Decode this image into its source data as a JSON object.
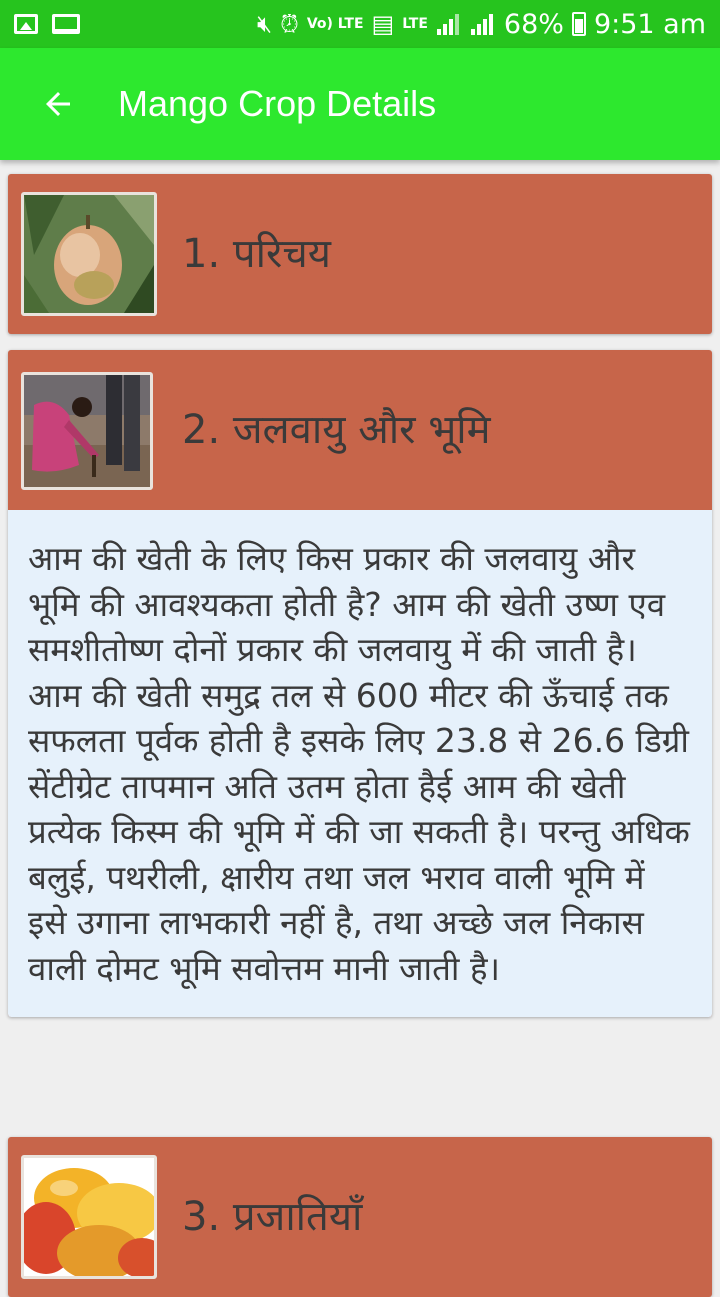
{
  "status_bar": {
    "battery": "68%",
    "time": "9:51 am",
    "volte_label": "Vo) LTE",
    "lte_label": "LTE"
  },
  "app_bar": {
    "title": "Mango Crop Details",
    "back_icon": "arrow-left-icon"
  },
  "sections": [
    {
      "title": "1. परिचय",
      "image": "mango-on-tree-photo"
    },
    {
      "title": "2. जलवायु और भूमि",
      "image": "farmer-planting-photo",
      "body": "आम की खेती के लिए किस प्रकार की जलवायु और भूमि की आवश्यकता होती है? आम की खेती उष्ण एव समशीतोष्ण दोनों प्रकार की जलवायु में की जाती है। आम की खेती समुद्र तल से 600 मीटर की ऊँचाई तक सफलता पूर्वक होती है इसके लिए 23.8 से 26.6 डिग्री सेंटीग्रेट तापमान अति उतम होता हैई आम की खेती प्रत्येक किस्म की भूमि में की जा सकती है। परन्तु अधिक बलुई, पथरीली, क्षारीय तथा जल भराव वाली भूमि में इसे उगाना लाभकारी नहीं है, तथा अच्छे जल निकास वाली दोमट भूमि सवोत्तम मानी जाती है।"
    },
    {
      "title": "3. प्रजातियाँ",
      "image": "mango-varieties-photo"
    }
  ],
  "colors": {
    "status_bar": "#26c41e",
    "app_bar": "#2de82e",
    "card": "#c7654a",
    "card_body": "#e6f1fb"
  }
}
